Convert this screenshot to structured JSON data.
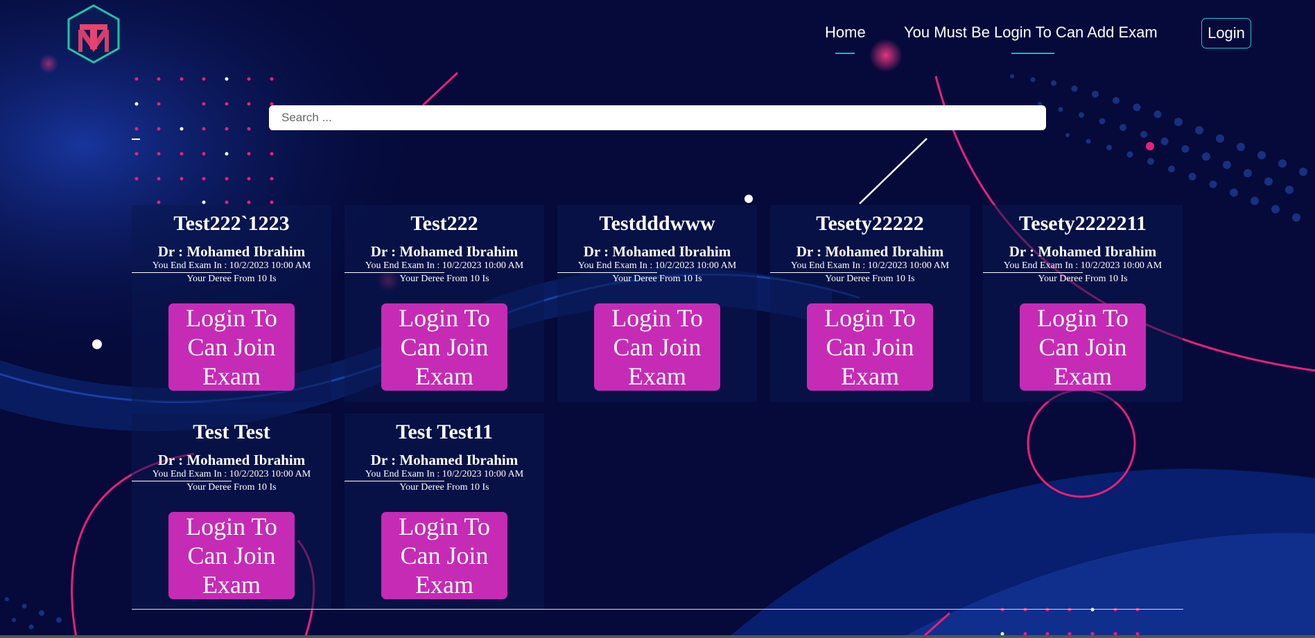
{
  "header": {
    "logo_icon": "tm-hexagon-logo-icon",
    "nav": {
      "home": "Home",
      "add_exam": "You Must Be Login To Can Add Exam",
      "login": "Login"
    }
  },
  "search": {
    "placeholder": "Search ..."
  },
  "cards": [
    {
      "title": "Test222`1223",
      "doctor": "Dr : Mohamed Ibrahim",
      "end": "You End Exam In : 10/2/2023 10:00 AM",
      "degree": "Your Deree From 10 Is",
      "button": "Login To Can Join Exam"
    },
    {
      "title": "Test222",
      "doctor": "Dr : Mohamed Ibrahim",
      "end": "You End Exam In : 10/2/2023 10:00 AM",
      "degree": "Your Deree From 10 Is",
      "button": "Login To Can Join Exam"
    },
    {
      "title": "Testdddwww",
      "doctor": "Dr : Mohamed Ibrahim",
      "end": "You End Exam In : 10/2/2023 10:00 AM",
      "degree": "Your Deree From 10 Is",
      "button": "Login To Can Join Exam"
    },
    {
      "title": "Tesety22222",
      "doctor": "Dr : Mohamed Ibrahim",
      "end": "You End Exam In : 10/2/2023 10:00 AM",
      "degree": "Your Deree From 10 Is",
      "button": "Login To Can Join Exam"
    },
    {
      "title": "Tesety2222211",
      "doctor": "Dr : Mohamed Ibrahim",
      "end": "You End Exam In : 10/2/2023 10:00 AM",
      "degree": "Your Deree From 10 Is",
      "button": "Login To Can Join Exam"
    },
    {
      "title": "Test Test",
      "doctor": "Dr : Mohamed Ibrahim",
      "end": "You End Exam In : 10/2/2023 10:00 AM",
      "degree": "Your Deree From 10 Is",
      "button": "Login To Can Join Exam"
    },
    {
      "title": "Test Test11",
      "doctor": "Dr : Mohamed Ibrahim",
      "end": "You End Exam In : 10/2/2023 10:00 AM",
      "degree": "Your Deree From 10 Is",
      "button": "Login To Can Join Exam"
    }
  ],
  "colors": {
    "background": "#050a3a",
    "accent_pink": "#e8207a",
    "button_magenta": "#c62bb5",
    "nav_accent": "#1fb4c8"
  }
}
